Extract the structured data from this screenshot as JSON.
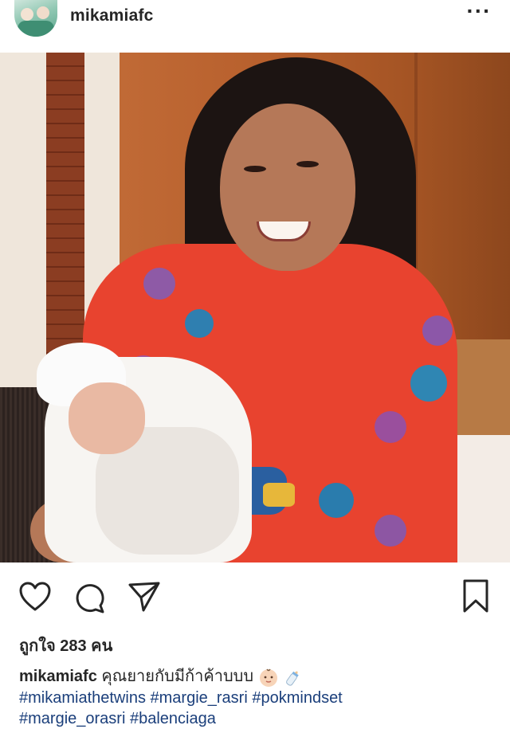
{
  "header": {
    "username": "mikamiafc",
    "more_icon": "more-horizontal-icon"
  },
  "photo": {
    "subject": "woman in red floral dress holding newborn baby"
  },
  "actions": {
    "icons": [
      "heart-icon",
      "comment-icon",
      "share-icon",
      "bookmark-icon"
    ]
  },
  "likes": {
    "text": "ถูกใจ 283 คน"
  },
  "caption": {
    "username": "mikamiafc",
    "text": "คุณยายกับมีก้าค้าบบบ",
    "emojis": [
      "baby-face-icon",
      "baby-bottle-icon"
    ],
    "line2": [
      "#mikamiathetwins",
      "#margie_rasri",
      "#pokmindset"
    ],
    "line3": [
      "#margie_orasri",
      "#balenciaga"
    ]
  }
}
